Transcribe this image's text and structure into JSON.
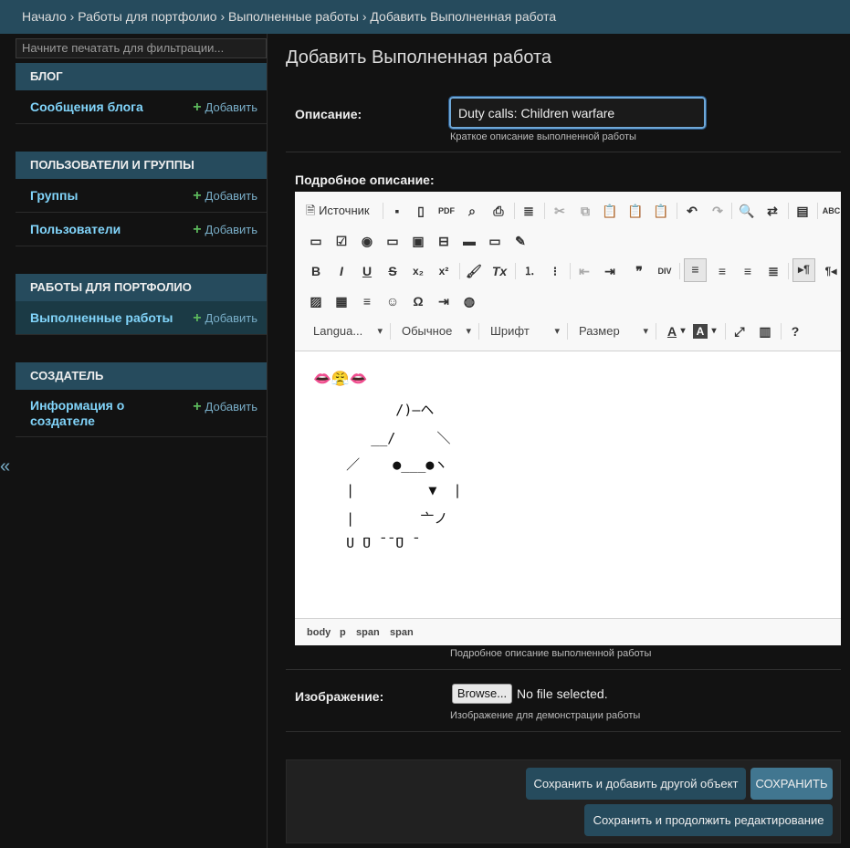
{
  "breadcrumbs": [
    "Начало",
    "Работы для портфолио",
    "Выполненные работы",
    "Добавить Выполненная работа"
  ],
  "breadcrumb_separator": "›",
  "sidebar": {
    "filter_placeholder": "Начните печатать для фильтрации...",
    "collapse_glyph": "«",
    "modules": [
      {
        "caption": "БЛОГ",
        "items": [
          {
            "name": "Сообщения блога",
            "add": "Добавить"
          }
        ]
      },
      {
        "caption": "ПОЛЬЗОВАТЕЛИ И ГРУППЫ",
        "items": [
          {
            "name": "Группы",
            "add": "Добавить"
          },
          {
            "name": "Пользователи",
            "add": "Добавить"
          }
        ]
      },
      {
        "caption": "РАБОТЫ ДЛЯ ПОРТФОЛИО",
        "items": [
          {
            "name": "Выполненные работы",
            "add": "Добавить"
          }
        ]
      },
      {
        "caption": "СОЗДАТЕЛЬ",
        "items": [
          {
            "name": "Информация о создателе",
            "add": "Добавить"
          }
        ]
      }
    ]
  },
  "page_title": "Добавить Выполненная работа",
  "form": {
    "description": {
      "label": "Описание:",
      "value": "Duty calls: Children warfare",
      "help": "Краткое описание выполненной работы"
    },
    "detailed": {
      "label": "Подробное описание:",
      "help": "Подробное описание выполненной работы",
      "toolbar": {
        "source_label": "Источник",
        "language": "Langua...",
        "format": "Обычное",
        "font": "Шрифт",
        "size": "Размер"
      },
      "content_art": [
        "👄😤👄",
        "          /)—ヘ",
        "       __/     ＼",
        "    ／    ●___●ヽ",
        "    |         ▼  |",
        "    |        亠ノ",
        "    U ̄U ̄ ̄ ̄U ̄"
      ],
      "path": [
        "body",
        "p",
        "span",
        "span"
      ]
    },
    "image": {
      "label": "Изображение:",
      "browse": "Browse...",
      "no_file": "No file selected.",
      "help": "Изображение для демонстрации работы"
    }
  },
  "buttons": {
    "save_add": "Сохранить и добавить другой объект",
    "save": "СОХРАНИТЬ",
    "save_continue": "Сохранить и продолжить редактирование"
  },
  "colors": {
    "header": "#264b5d",
    "link": "#81d4fa",
    "add_plus": "#5cb85c",
    "background": "#121212"
  }
}
